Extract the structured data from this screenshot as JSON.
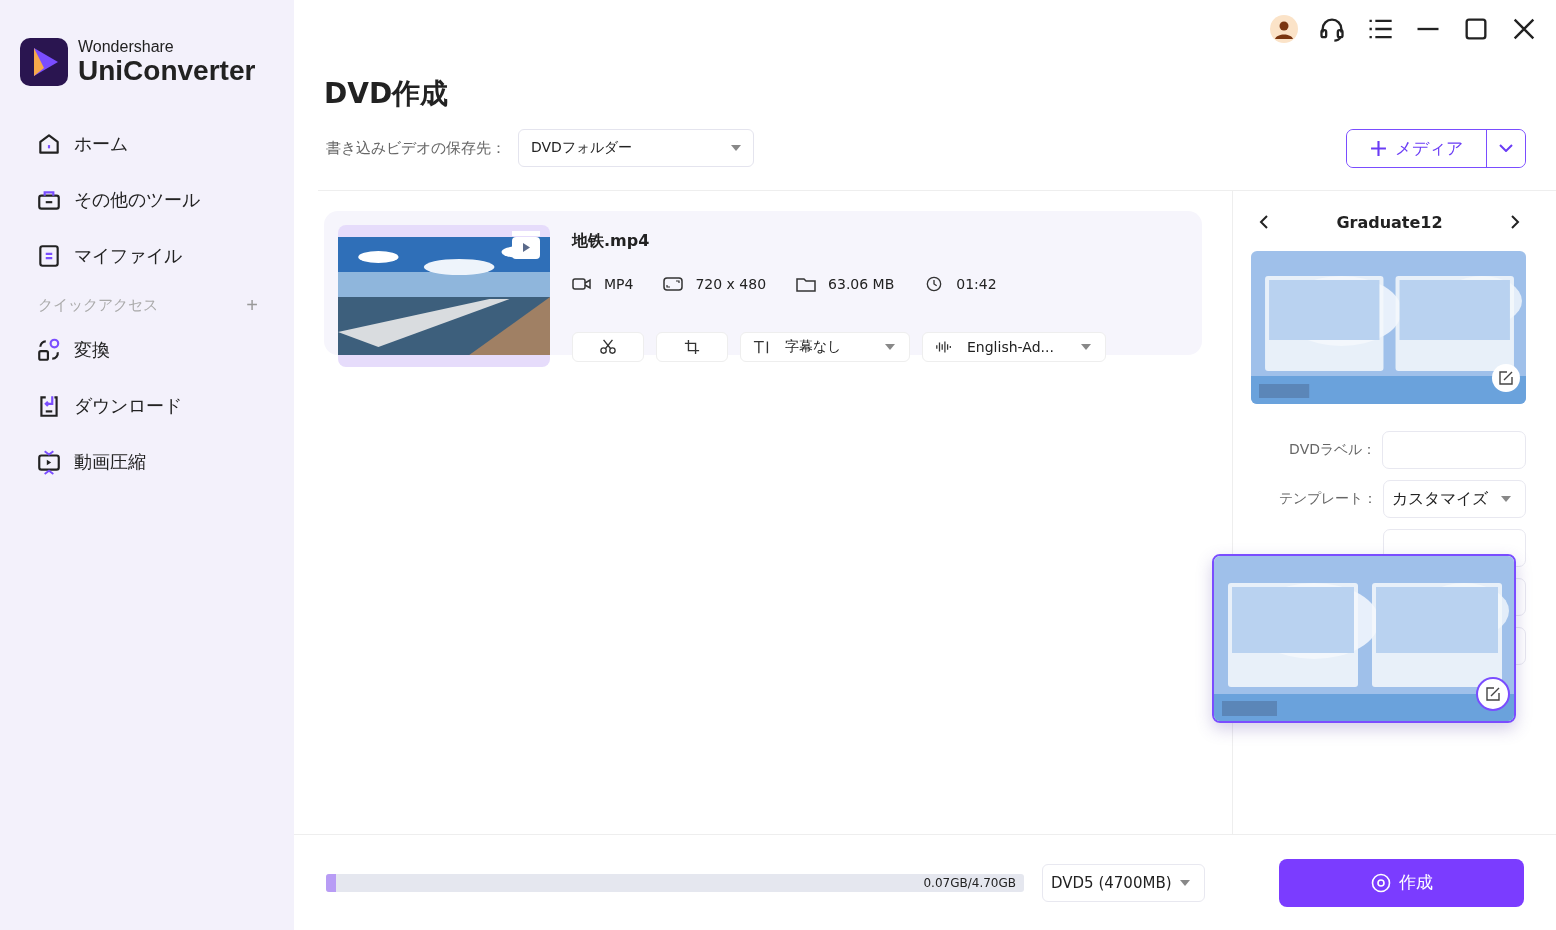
{
  "app": {
    "brand": "Wondershare",
    "name": "UniConverter"
  },
  "nav": [
    {
      "label": "ホーム"
    },
    {
      "label": "その他のツール"
    },
    {
      "label": "マイファイル"
    }
  ],
  "quick_access": {
    "title": "クイックアクセス",
    "add": "+",
    "items": [
      {
        "label": "変換"
      },
      {
        "label": "ダウンロード"
      },
      {
        "label": "動画圧縮"
      }
    ]
  },
  "page": {
    "title": "DVD作成",
    "save_label": "書き込みビデオの保存先：",
    "save_target": "DVDフォルダー",
    "add_media": "メディア"
  },
  "file": {
    "name": "地铁.mp4",
    "format": "MP4",
    "resolution": "720 x 480",
    "size": "63.06 MB",
    "duration": "01:42",
    "subtitle": "字幕なし",
    "audio": "English-Ad..."
  },
  "template": {
    "name": "Graduate12",
    "fields": [
      {
        "label": "DVDラベル：",
        "kind": "input"
      },
      {
        "label": "テンプレート：",
        "kind": "select",
        "value": "カスタマイズ"
      }
    ]
  },
  "bottom": {
    "usage": "0.07GB/4.70GB",
    "level": 0.015,
    "disc": "DVD5 (4700MB)",
    "create": "作成"
  }
}
